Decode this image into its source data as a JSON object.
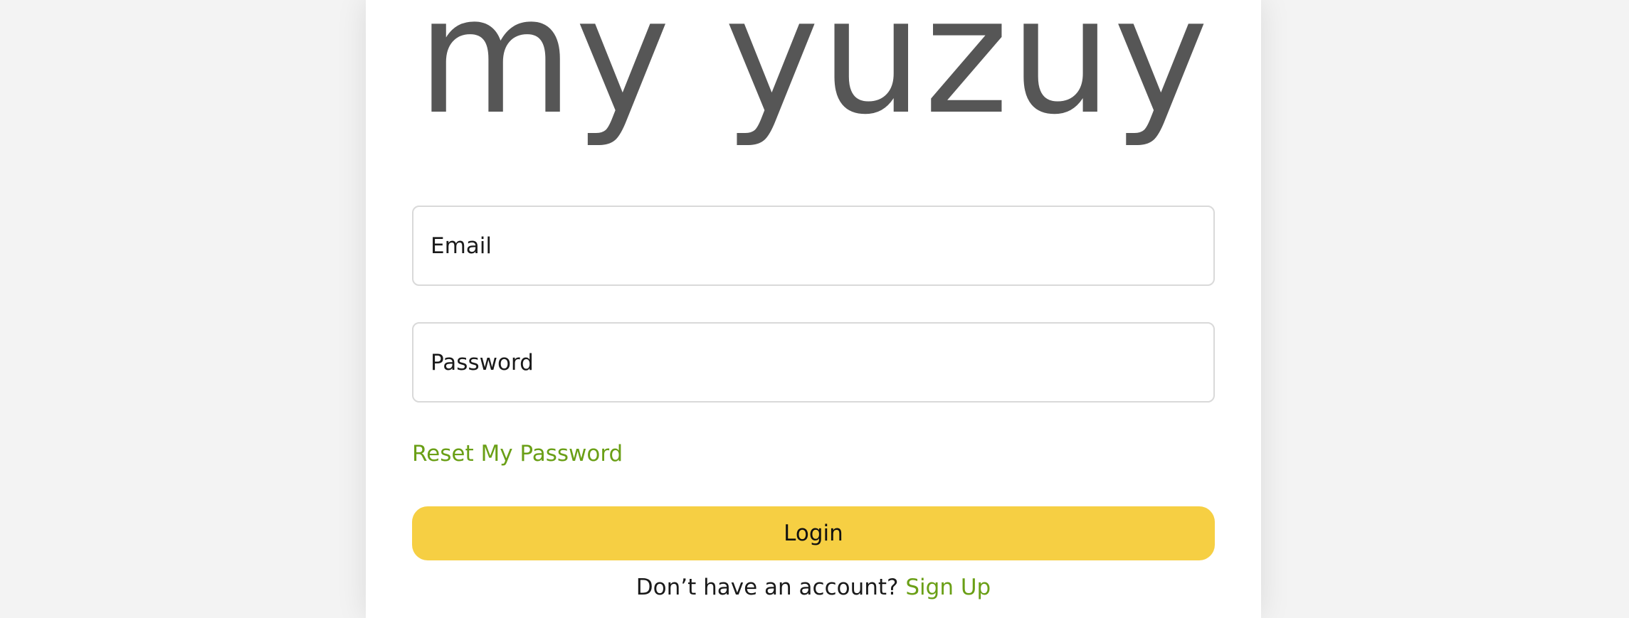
{
  "logo": {
    "text": "my yuzuy",
    "color": "#565656"
  },
  "form": {
    "email_placeholder": "Email",
    "password_placeholder": "Password",
    "reset_link": "Reset My Password",
    "login_button": "Login",
    "signup_prompt": "Don’t have an account?",
    "signup_link": "Sign Up"
  },
  "colors": {
    "accent_green": "#6a9f16",
    "button_yellow": "#f6cf43",
    "background": "#f3f3f3"
  }
}
